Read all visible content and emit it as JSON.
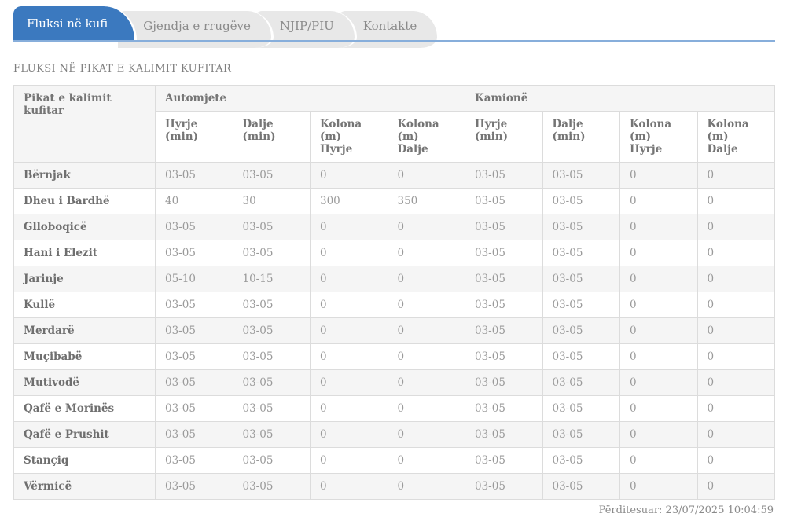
{
  "colors": {
    "accent_blue": "#3b79bf",
    "tab_inactive_bg": "#e8e8e8",
    "row_stripe": "#f5f5f5",
    "table_border": "#dcdcdc"
  },
  "tabs": [
    {
      "id": "fluksi-ne-kufi",
      "label": "Fluksi në kufi",
      "active": true
    },
    {
      "id": "gjendja-e-rrugeve",
      "label": "Gjendja e rrugëve",
      "active": false
    },
    {
      "id": "njip-piu",
      "label": "NJIP/PIU",
      "active": false
    },
    {
      "id": "kontakte",
      "label": "Kontakte",
      "active": false
    }
  ],
  "heading": "FLUKSI NË PIKAT E KALIMIT KUFITAR",
  "table": {
    "corner_header": "Pikat e kalimit kufitar",
    "group_headers": [
      "Automjete",
      "Kamionë"
    ],
    "sub_headers": [
      "Hyrje (min)",
      "Dalje (min)",
      "Kolona (m)\nHyrje",
      "Kolona (m)\nDalje",
      "Hyrje (min)",
      "Dalje (min)",
      "Kolona (m)\nHyrje",
      "Kolona (m)\nDalje"
    ],
    "rows": [
      {
        "name": "Bërnjak",
        "values": [
          "03-05",
          "03-05",
          "0",
          "0",
          "03-05",
          "03-05",
          "0",
          "0"
        ]
      },
      {
        "name": "Dheu i Bardhë",
        "values": [
          "40",
          "30",
          "300",
          "350",
          "03-05",
          "03-05",
          "0",
          "0"
        ]
      },
      {
        "name": "Glloboqicë",
        "values": [
          "03-05",
          "03-05",
          "0",
          "0",
          "03-05",
          "03-05",
          "0",
          "0"
        ]
      },
      {
        "name": "Hani i Elezit",
        "values": [
          "03-05",
          "03-05",
          "0",
          "0",
          "03-05",
          "03-05",
          "0",
          "0"
        ]
      },
      {
        "name": "Jarinje",
        "values": [
          "05-10",
          "10-15",
          "0",
          "0",
          "03-05",
          "03-05",
          "0",
          "0"
        ]
      },
      {
        "name": "Kullë",
        "values": [
          "03-05",
          "03-05",
          "0",
          "0",
          "03-05",
          "03-05",
          "0",
          "0"
        ]
      },
      {
        "name": "Merdarë",
        "values": [
          "03-05",
          "03-05",
          "0",
          "0",
          "03-05",
          "03-05",
          "0",
          "0"
        ]
      },
      {
        "name": "Muçibabë",
        "values": [
          "03-05",
          "03-05",
          "0",
          "0",
          "03-05",
          "03-05",
          "0",
          "0"
        ]
      },
      {
        "name": "Mutivodë",
        "values": [
          "03-05",
          "03-05",
          "0",
          "0",
          "03-05",
          "03-05",
          "0",
          "0"
        ]
      },
      {
        "name": "Qafë e Morinës",
        "values": [
          "03-05",
          "03-05",
          "0",
          "0",
          "03-05",
          "03-05",
          "0",
          "0"
        ]
      },
      {
        "name": "Qafë e Prushit",
        "values": [
          "03-05",
          "03-05",
          "0",
          "0",
          "03-05",
          "03-05",
          "0",
          "0"
        ]
      },
      {
        "name": "Stançiq",
        "values": [
          "03-05",
          "03-05",
          "0",
          "0",
          "03-05",
          "03-05",
          "0",
          "0"
        ]
      },
      {
        "name": "Vërmicë",
        "values": [
          "03-05",
          "03-05",
          "0",
          "0",
          "03-05",
          "03-05",
          "0",
          "0"
        ]
      }
    ]
  },
  "footer": {
    "updated": "Përditesuar: 23/07/2025 10:04:59"
  }
}
